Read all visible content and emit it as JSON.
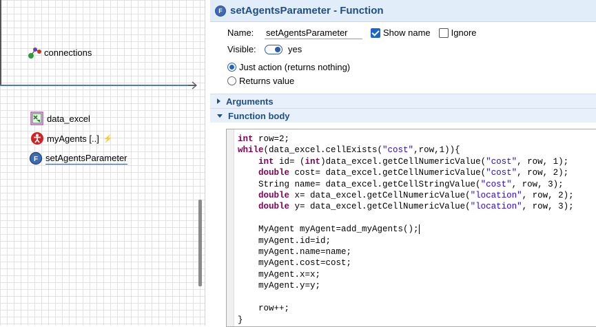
{
  "canvas": {
    "items": [
      {
        "label": "connections",
        "icon": "connections-icon"
      },
      {
        "label": "data_excel",
        "icon": "excel-file-icon"
      },
      {
        "label": "myAgents [..]",
        "icon": "agent-population-icon",
        "extra": "⚡"
      },
      {
        "label": "setAgentsParameter",
        "icon": "function-icon"
      }
    ]
  },
  "panel": {
    "title": "setAgentsParameter - Function",
    "name_label": "Name:",
    "name_value": "setAgentsParameter",
    "show_name_label": "Show name",
    "show_name_checked": true,
    "ignore_label": "Ignore",
    "ignore_checked": false,
    "visible_label": "Visible:",
    "visible_value": "yes",
    "radio_just_action": "Just action (returns nothing)",
    "radio_returns_value": "Returns value",
    "selected_return": "just_action",
    "section_arguments": "Arguments",
    "section_function_body": "Function body",
    "code_lines": [
      [
        [
          "kw",
          "int"
        ],
        [
          "t",
          " row=2;"
        ]
      ],
      [
        [
          "kw",
          "while"
        ],
        [
          "t",
          "(data_excel.cellExists("
        ],
        [
          "st",
          "\"cost\""
        ],
        [
          "t",
          ",row,1)){"
        ]
      ],
      [
        [
          "t",
          "    "
        ],
        [
          "kw",
          "int"
        ],
        [
          "t",
          " id= ("
        ],
        [
          "kw",
          "int"
        ],
        [
          "t",
          ")data_excel.getCellNumericValue("
        ],
        [
          "st",
          "\"cost\""
        ],
        [
          "t",
          ", row, 1);"
        ]
      ],
      [
        [
          "t",
          "    "
        ],
        [
          "kw",
          "double"
        ],
        [
          "t",
          " cost= data_excel.getCellNumericValue("
        ],
        [
          "st",
          "\"cost\""
        ],
        [
          "t",
          ", row, 2);"
        ]
      ],
      [
        [
          "t",
          "    String name= data_excel.getCellStringValue("
        ],
        [
          "st",
          "\"cost\""
        ],
        [
          "t",
          ", row, 3);"
        ]
      ],
      [
        [
          "t",
          "    "
        ],
        [
          "kw",
          "double"
        ],
        [
          "t",
          " x= data_excel.getCellNumericValue("
        ],
        [
          "st",
          "\"location\""
        ],
        [
          "t",
          ", row, 2);"
        ]
      ],
      [
        [
          "t",
          "    "
        ],
        [
          "kw",
          "double"
        ],
        [
          "t",
          " y= data_excel.getCellNumericValue("
        ],
        [
          "st",
          "\"location\""
        ],
        [
          "t",
          ", row, 3);"
        ]
      ],
      [
        [
          "t",
          ""
        ]
      ],
      [
        [
          "t",
          "    MyAgent myAgent=add_myAgents();"
        ],
        [
          "caret",
          ""
        ]
      ],
      [
        [
          "t",
          "    myAgent.id=id;"
        ]
      ],
      [
        [
          "t",
          "    myAgent.name=name;"
        ]
      ],
      [
        [
          "t",
          "    myAgent.cost=cost;"
        ]
      ],
      [
        [
          "t",
          "    myAgent.x=x;"
        ]
      ],
      [
        [
          "t",
          "    myAgent.y=y;"
        ]
      ],
      [
        [
          "t",
          ""
        ]
      ],
      [
        [
          "t",
          "    row++;"
        ]
      ],
      [
        [
          "t",
          "}"
        ]
      ]
    ]
  },
  "colors": {
    "keyword": "#7f0055",
    "string": "#2a00ff",
    "accent": "#1f4e89",
    "section_bg": "#e7f0fb"
  }
}
